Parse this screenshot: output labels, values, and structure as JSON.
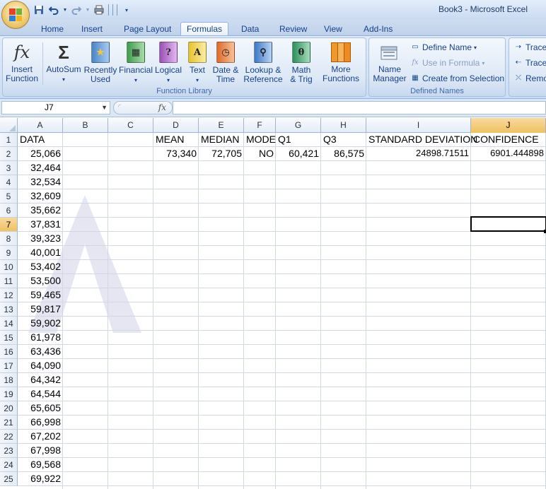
{
  "window": {
    "title": "Book3 - Microsoft Excel"
  },
  "quick_access": {
    "icons": [
      "save-icon",
      "undo-icon",
      "redo-icon",
      "print-preview-icon",
      "customize-icon"
    ]
  },
  "tabs": [
    "Home",
    "Insert",
    "Page Layout",
    "Formulas",
    "Data",
    "Review",
    "View",
    "Add-Ins"
  ],
  "active_tab": "Formulas",
  "ribbon": {
    "function_library": {
      "label": "Function Library",
      "insert_function": "Insert\nFunction",
      "autosum": "AutoSum",
      "recently_used": "Recently\nUsed",
      "financial": "Financial",
      "logical": "Logical",
      "text": "Text",
      "date_time": "Date &\nTime",
      "lookup_reference": "Lookup &\nReference",
      "math_trig": "Math\n& Trig",
      "more_functions": "More\nFunctions"
    },
    "defined_names": {
      "label": "Defined Names",
      "name_manager": "Name\nManager",
      "define_name": "Define Name",
      "use_in_formula": "Use in Formula",
      "create_from_selection": "Create from Selection"
    },
    "formula_auditing": {
      "trace_precedents": "Trace",
      "trace_dependents": "Trace",
      "remove_arrows": "Remo"
    }
  },
  "formula_bar": {
    "name_box": "J7",
    "fx": "fx",
    "formula": ""
  },
  "sheet": {
    "columns": [
      "A",
      "B",
      "C",
      "D",
      "E",
      "F",
      "G",
      "H",
      "I",
      "J"
    ],
    "selected_column": "J",
    "selected_row": "7",
    "rows": [
      "1",
      "2",
      "3",
      "4",
      "5",
      "6",
      "7",
      "8",
      "9",
      "10",
      "11",
      "12",
      "13",
      "14",
      "15",
      "16",
      "17",
      "18",
      "19",
      "20",
      "21",
      "22",
      "23",
      "24",
      "25"
    ],
    "headers": {
      "A1": "DATA",
      "D1": "MEAN",
      "E1": "MEDIAN",
      "F1": "MODE",
      "G1": "Q1",
      "H1": "Q3",
      "I1": "STANDARD DEVIATION",
      "J1": "CONFIDENCE"
    },
    "stats": {
      "D2": "73,340",
      "E2": "72,705",
      "F2": "NO",
      "G2": "60,421",
      "H2": "86,575",
      "I2": "24898.71511",
      "J2": "6901.444898"
    },
    "data_values": [
      "25,066",
      "32,464",
      "32,534",
      "32,609",
      "35,662",
      "37,831",
      "39,323",
      "40,001",
      "53,402",
      "53,500",
      "59,465",
      "59,817",
      "59,902",
      "61,978",
      "63,436",
      "64,090",
      "64,342",
      "64,544",
      "65,605",
      "66,998",
      "67,202",
      "67,998",
      "69,568",
      "69,922"
    ]
  }
}
